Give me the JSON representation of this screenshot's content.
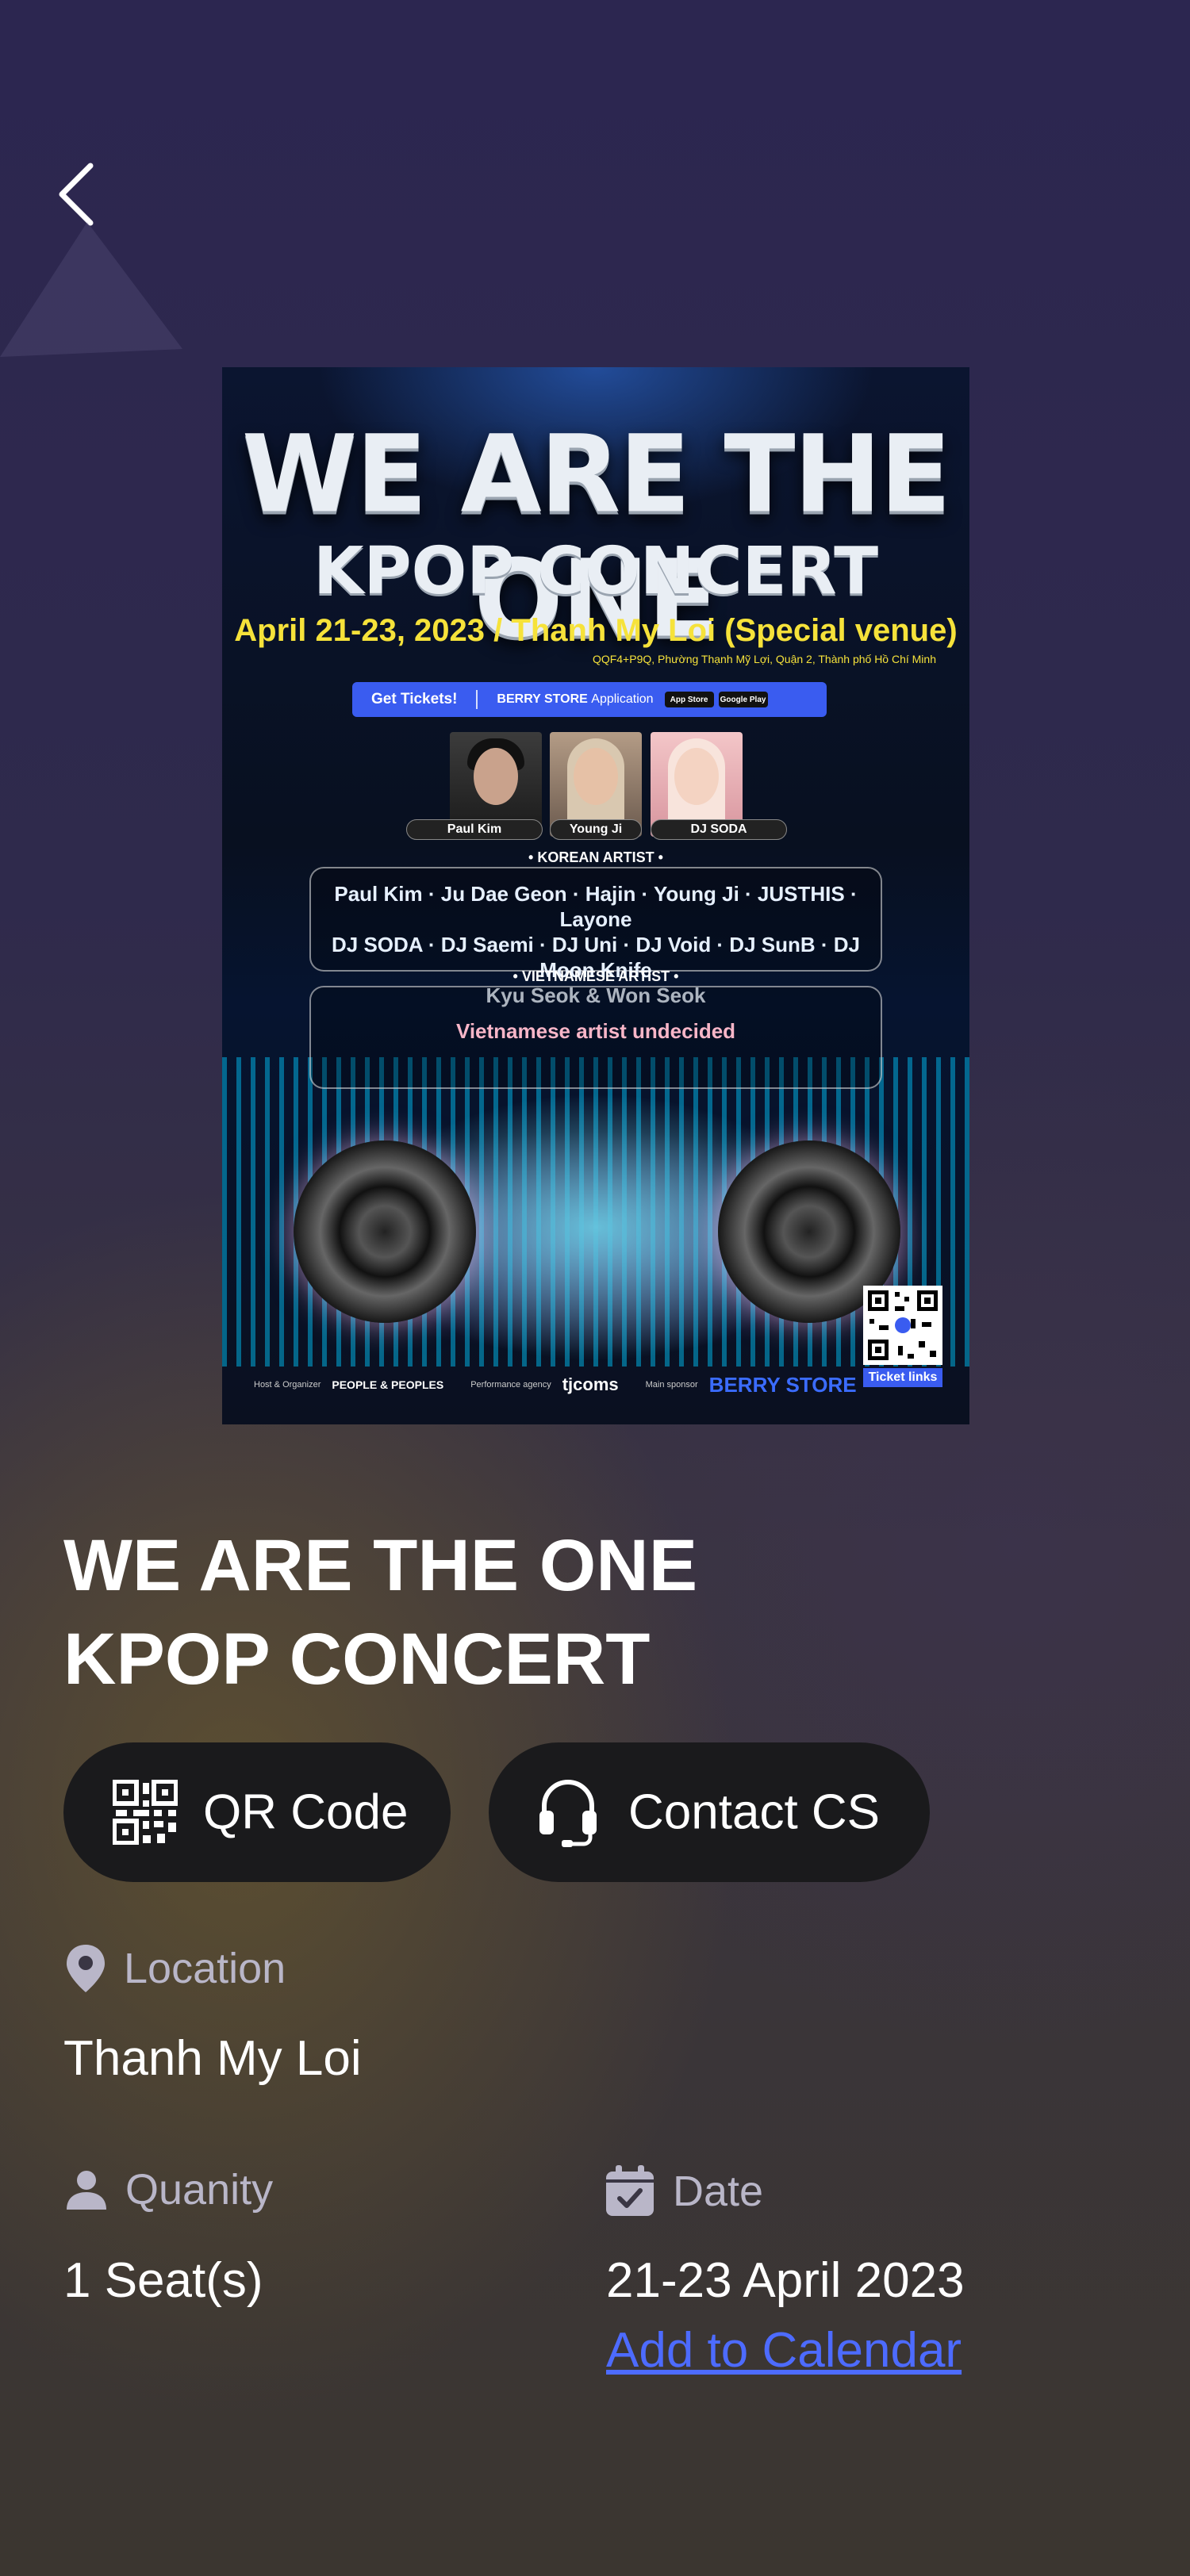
{
  "nav": {
    "back_icon": "chevron-left-icon"
  },
  "poster": {
    "title_line1": "WE ARE THE ONE",
    "title_line2": "KPOP CONCERT",
    "date_venue": "April 21-23, 2023 / Thanh My Loi (Special venue)",
    "address": "QQF4+P9Q, Phường Thạnh Mỹ Lợi, Quận 2, Thành phố Hồ Chí Minh",
    "tickets_label": "Get Tickets!",
    "store_label": "BERRY STORE",
    "store_suffix": "Application",
    "badge_appstore": "App Store",
    "badge_googleplay": "Google Play",
    "artists": [
      "Paul Kim",
      "Young Ji",
      "DJ SODA"
    ],
    "korean_heading": "• KOREAN ARTIST •",
    "korean_line1": "Paul Kim · Ju Dae Geon · Hajin · Young Ji · JUSTHIS · Layone",
    "korean_line2": "DJ SODA · DJ Saemi · DJ Uni · DJ Void · DJ SunB · DJ Moon Knife",
    "korean_line3": "Kyu Seok & Won Seok",
    "vietnamese_heading": "• VIETNAMESE ARTIST •",
    "vietnamese_text": "Vietnamese artist undecided",
    "footer_host_label": "Host & Organizer",
    "footer_host": "PEOPLE & PEOPLES",
    "footer_perf_label": "Performance agency",
    "footer_perf": "tjcoms",
    "footer_sponsor_label": "Main sponsor",
    "footer_sponsor": "BERRY STORE",
    "ticket_links": "Ticket links"
  },
  "event": {
    "title_line1": "WE ARE THE ONE",
    "title_line2": "KPOP CONCERT"
  },
  "actions": {
    "qr_label": "QR Code",
    "contact_label": "Contact CS"
  },
  "details": {
    "location_label": "Location",
    "location_value": "Thanh My Loi",
    "quantity_label": "Quanity",
    "quantity_value": "1 Seat(s)",
    "date_label": "Date",
    "date_value": "21-23 April 2023",
    "calendar_link": "Add to Calendar"
  },
  "colors": {
    "accent_link": "#4d6bff",
    "pill_bg": "#1a1a1c",
    "muted_text": "#b9b6c8",
    "poster_yellow": "#f6e23a",
    "poster_blue": "#3a5cf0"
  }
}
